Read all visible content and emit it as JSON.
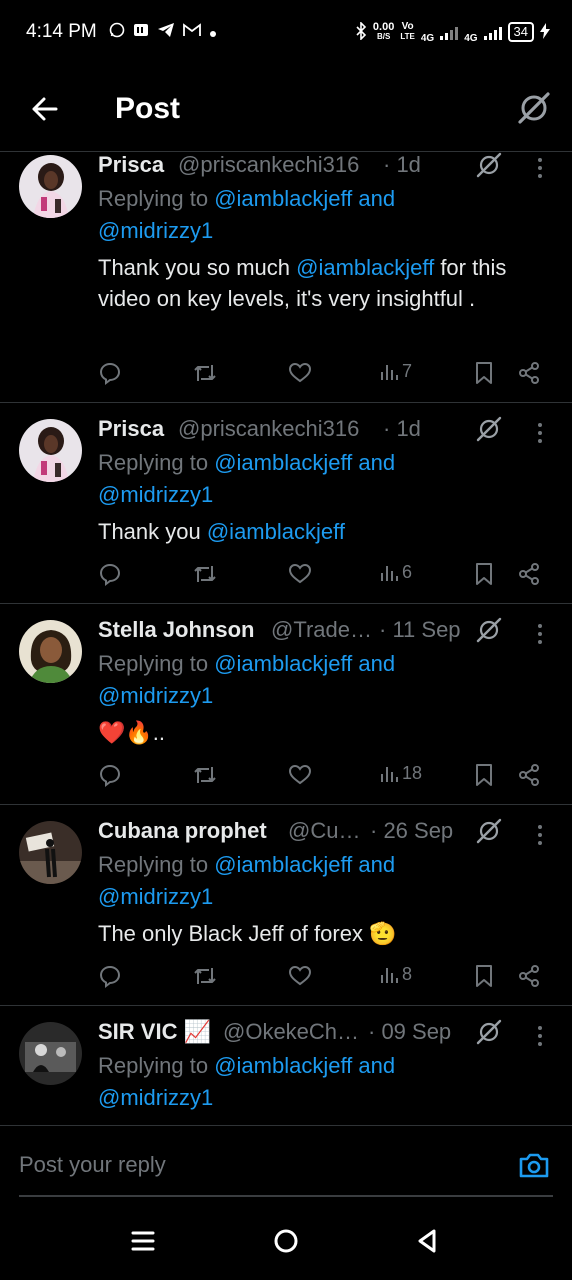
{
  "status_bar": {
    "time": "4:14 PM",
    "net_speed_value": "0.00",
    "net_speed_unit": "B/S",
    "volte_top": "Vo",
    "volte_bottom": "LTE",
    "net1": "4G",
    "net2": "4G",
    "battery": "34"
  },
  "header": {
    "title": "Post"
  },
  "tweets": [
    {
      "name": "Prisca",
      "handle": "@priscankechi316",
      "time": "· 1d",
      "reply_prefix": "Replying to",
      "reply_mention1": "@iamblackjeff and",
      "reply_mention2": "@midrizzy1",
      "body_before": "Thank you so much ",
      "body_mention": "@iamblackjeff",
      "body_after": "  for this video on key levels, it's very insightful .",
      "views": "7"
    },
    {
      "name": "Prisca",
      "handle": "@priscankechi316",
      "time": "· 1d",
      "reply_prefix": "Replying to",
      "reply_mention1": "@iamblackjeff and",
      "reply_mention2": "@midrizzy1",
      "body_before": "Thank you ",
      "body_mention": "@iamblackjeff",
      "body_after": "",
      "views": "6"
    },
    {
      "name": "Stella Johnson",
      "handle": "@Trade…",
      "time": "· 11 Sep",
      "reply_prefix": "Replying to",
      "reply_mention1": "@iamblackjeff and",
      "reply_mention2": "@midrizzy1",
      "body_before": "❤️🔥..",
      "body_mention": "",
      "body_after": "",
      "views": "18"
    },
    {
      "name": "Cubana prophet",
      "handle": "@Cu…",
      "time": "· 26 Sep",
      "reply_prefix": "Replying to",
      "reply_mention1": "@iamblackjeff and",
      "reply_mention2": "@midrizzy1",
      "body_before": "The only Black Jeff of forex 🫡",
      "body_mention": "",
      "body_after": "",
      "views": "8"
    },
    {
      "name": "SIR VIC 📈",
      "handle": "@OkekeCh…",
      "time": "· 09 Sep",
      "reply_prefix": "Replying to",
      "reply_mention1": "@iamblackjeff and",
      "reply_mention2": "@midrizzy1"
    }
  ],
  "composer": {
    "placeholder": "Post your reply"
  },
  "icons": {
    "back": "arrow-left-icon",
    "grok": "grok-icon",
    "reply": "reply-icon",
    "retweet": "retweet-icon",
    "like": "heart-icon",
    "views": "views-icon",
    "bookmark": "bookmark-icon",
    "share": "share-icon",
    "camera": "camera-icon"
  },
  "colors": {
    "background": "#000000",
    "accent": "#1d9bf0",
    "muted": "#71767b",
    "text": "#e7e9ea"
  }
}
